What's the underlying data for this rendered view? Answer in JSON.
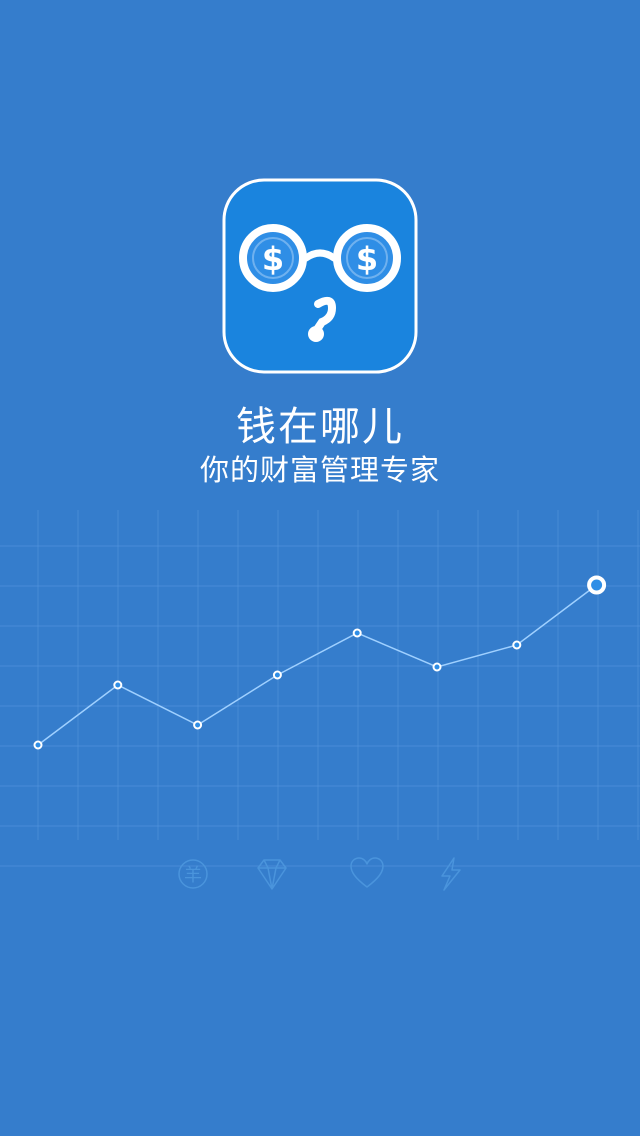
{
  "app": {
    "name": "钱在哪儿",
    "slogan": "你的财富管理专家"
  },
  "logo": {
    "icon": "money-glasses-logo",
    "lens_symbol": "$",
    "colors": {
      "badge_bg": "#1a84de",
      "lens_fill": "#2f8ee6",
      "stroke": "#ffffff"
    }
  },
  "feature_icons": [
    {
      "name": "yuan-coin-icon",
      "label": "羊"
    },
    {
      "name": "diamond-icon"
    },
    {
      "name": "heart-icon"
    },
    {
      "name": "lightning-icon"
    }
  ],
  "chart_data": {
    "type": "line",
    "x": [
      1,
      2,
      3,
      4,
      5,
      6,
      7,
      8
    ],
    "values": [
      1.0,
      2.5,
      1.5,
      2.75,
      3.8,
      2.95,
      3.5,
      5.0
    ],
    "grid": true,
    "highlight_last_point": true
  },
  "colors": {
    "background": "#357dcc",
    "grid": "#5b9ae0",
    "line": "#9fd0ff",
    "point_fill": "#ffffff"
  }
}
